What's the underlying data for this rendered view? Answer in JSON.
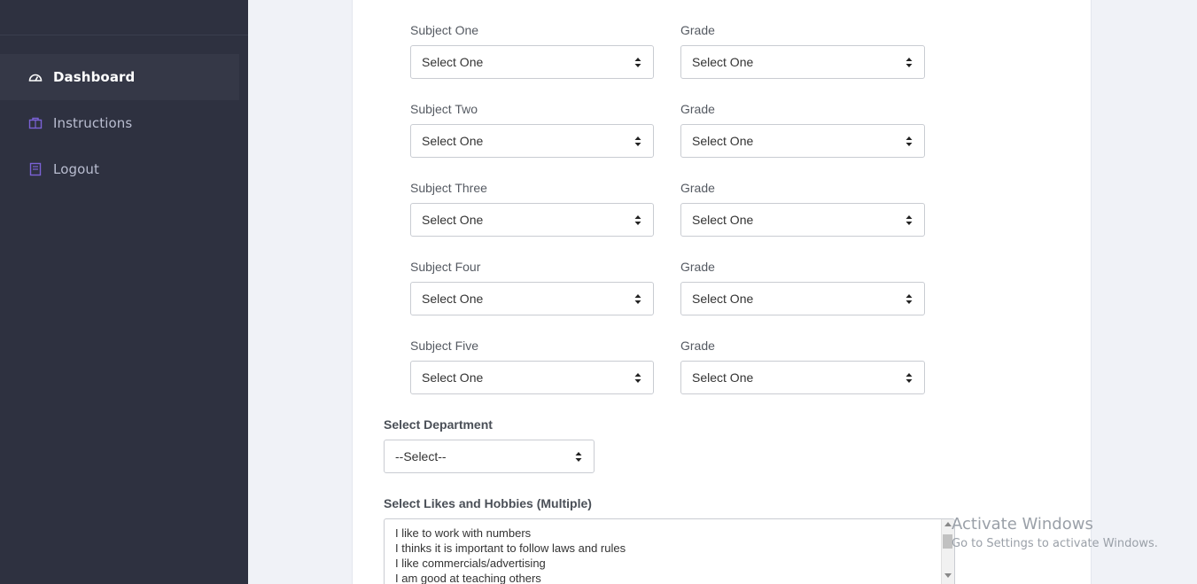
{
  "sidebar": {
    "items": [
      {
        "label": "Dashboard",
        "icon": "dashboard-gauge-icon",
        "active": true
      },
      {
        "label": "Instructions",
        "icon": "box-icon",
        "active": false
      },
      {
        "label": "Logout",
        "icon": "book-icon",
        "active": false
      }
    ]
  },
  "form": {
    "subjects": [
      {
        "subject_label": "Subject One",
        "subject_value": "Select One",
        "grade_label": "Grade",
        "grade_value": "Select One"
      },
      {
        "subject_label": "Subject Two",
        "subject_value": "Select One",
        "grade_label": "Grade",
        "grade_value": "Select One"
      },
      {
        "subject_label": "Subject Three",
        "subject_value": "Select One",
        "grade_label": "Grade",
        "grade_value": "Select One"
      },
      {
        "subject_label": "Subject Four",
        "subject_value": "Select One",
        "grade_label": "Grade",
        "grade_value": "Select One"
      },
      {
        "subject_label": "Subject Five",
        "subject_value": "Select One",
        "grade_label": "Grade",
        "grade_value": "Select One"
      }
    ],
    "department": {
      "label": "Select Department",
      "value": "--Select--"
    },
    "hobbies": {
      "label": "Select Likes and Hobbies (Multiple)",
      "options": [
        "I like to work with numbers",
        "I thinks it is important to follow laws and rules",
        "I like commercials/advertising",
        "I am good at teaching others"
      ]
    }
  },
  "watermark": {
    "title": "Activate Windows",
    "subtitle": "Go to Settings to activate Windows."
  },
  "colors": {
    "sidebar_bg": "#2e3140",
    "accent_icon": "#7b62d6",
    "page_bg": "#f0f2f7"
  }
}
